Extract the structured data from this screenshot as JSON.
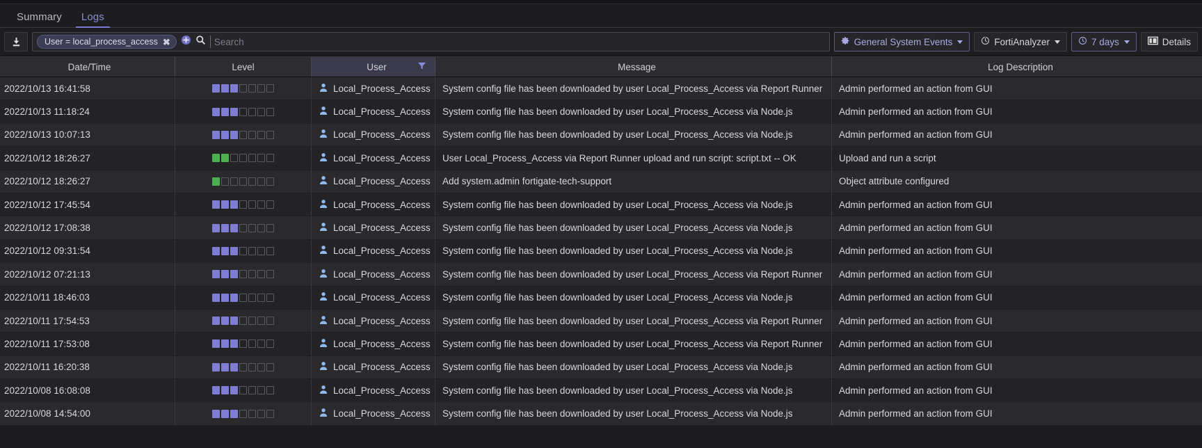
{
  "tabs": [
    {
      "label": "Summary",
      "active": false
    },
    {
      "label": "Logs",
      "active": true
    }
  ],
  "toolbar": {
    "export_icon": "download-icon",
    "filter_chip": {
      "text": "User = local_process_access",
      "remove": "✖"
    },
    "add_filter_icon": "plus-circle-icon",
    "search_icon": "search-icon",
    "search_value": "",
    "search_placeholder": "Search",
    "log_type_button": {
      "label": "General System Events",
      "icon": "gear-icon"
    },
    "device_button": {
      "label": "FortiAnalyzer",
      "icon": "history-icon"
    },
    "time_button": {
      "label": "7 days",
      "icon": "clock-icon"
    },
    "details_button": {
      "label": "Details",
      "icon": "panel-icon"
    }
  },
  "table": {
    "columns": [
      {
        "label": "Date/Time",
        "key": "datetime",
        "filtered": false
      },
      {
        "label": "Level",
        "key": "level",
        "filtered": false
      },
      {
        "label": "User",
        "key": "user",
        "filtered": true
      },
      {
        "label": "Message",
        "key": "message",
        "filtered": false
      },
      {
        "label": "Log Description",
        "key": "description",
        "filtered": false
      }
    ],
    "rows": [
      {
        "datetime": "2022/10/13 16:41:58",
        "level_filled": 3,
        "level_color": "blue",
        "user": "Local_Process_Access",
        "message": "System config file has been downloaded by user Local_Process_Access via Report Runner",
        "description": "Admin performed an action from GUI"
      },
      {
        "datetime": "2022/10/13 11:18:24",
        "level_filled": 3,
        "level_color": "blue",
        "user": "Local_Process_Access",
        "message": "System config file has been downloaded by user Local_Process_Access via Node.js",
        "description": "Admin performed an action from GUI"
      },
      {
        "datetime": "2022/10/13 10:07:13",
        "level_filled": 3,
        "level_color": "blue",
        "user": "Local_Process_Access",
        "message": "System config file has been downloaded by user Local_Process_Access via Node.js",
        "description": "Admin performed an action from GUI"
      },
      {
        "datetime": "2022/10/12 18:26:27",
        "level_filled": 2,
        "level_color": "green",
        "user": "Local_Process_Access",
        "message": "User Local_Process_Access via Report Runner upload and run script: script.txt -- OK",
        "description": "Upload and run a script"
      },
      {
        "datetime": "2022/10/12 18:26:27",
        "level_filled": 1,
        "level_color": "green",
        "user": "Local_Process_Access",
        "message": "Add system.admin fortigate-tech-support",
        "description": "Object attribute configured"
      },
      {
        "datetime": "2022/10/12 17:45:54",
        "level_filled": 3,
        "level_color": "blue",
        "user": "Local_Process_Access",
        "message": "System config file has been downloaded by user Local_Process_Access via Node.js",
        "description": "Admin performed an action from GUI"
      },
      {
        "datetime": "2022/10/12 17:08:38",
        "level_filled": 3,
        "level_color": "blue",
        "user": "Local_Process_Access",
        "message": "System config file has been downloaded by user Local_Process_Access via Node.js",
        "description": "Admin performed an action from GUI"
      },
      {
        "datetime": "2022/10/12 09:31:54",
        "level_filled": 3,
        "level_color": "blue",
        "user": "Local_Process_Access",
        "message": "System config file has been downloaded by user Local_Process_Access via Node.js",
        "description": "Admin performed an action from GUI"
      },
      {
        "datetime": "2022/10/12 07:21:13",
        "level_filled": 3,
        "level_color": "blue",
        "user": "Local_Process_Access",
        "message": "System config file has been downloaded by user Local_Process_Access via Report Runner",
        "description": "Admin performed an action from GUI"
      },
      {
        "datetime": "2022/10/11 18:46:03",
        "level_filled": 3,
        "level_color": "blue",
        "user": "Local_Process_Access",
        "message": "System config file has been downloaded by user Local_Process_Access via Node.js",
        "description": "Admin performed an action from GUI"
      },
      {
        "datetime": "2022/10/11 17:54:53",
        "level_filled": 3,
        "level_color": "blue",
        "user": "Local_Process_Access",
        "message": "System config file has been downloaded by user Local_Process_Access via Report Runner",
        "description": "Admin performed an action from GUI"
      },
      {
        "datetime": "2022/10/11 17:53:08",
        "level_filled": 3,
        "level_color": "blue",
        "user": "Local_Process_Access",
        "message": "System config file has been downloaded by user Local_Process_Access via Report Runner",
        "description": "Admin performed an action from GUI"
      },
      {
        "datetime": "2022/10/11 16:20:38",
        "level_filled": 3,
        "level_color": "blue",
        "user": "Local_Process_Access",
        "message": "System config file has been downloaded by user Local_Process_Access via Node.js",
        "description": "Admin performed an action from GUI"
      },
      {
        "datetime": "2022/10/08 16:08:08",
        "level_filled": 3,
        "level_color": "blue",
        "user": "Local_Process_Access",
        "message": "System config file has been downloaded by user Local_Process_Access via Node.js",
        "description": "Admin performed an action from GUI"
      },
      {
        "datetime": "2022/10/08 14:54:00",
        "level_filled": 3,
        "level_color": "blue",
        "user": "Local_Process_Access",
        "message": "System config file has been downloaded by user Local_Process_Access via Node.js",
        "description": "Admin performed an action from GUI"
      }
    ],
    "level_segments": 7
  },
  "colors": {
    "accent": "#7d7dd4",
    "green": "#4caf50",
    "background": "#1d1d1f",
    "row_odd": "#2a2a2d",
    "row_even": "#232326",
    "header": "#2d2d31",
    "selected_header": "#3a3a4c"
  }
}
